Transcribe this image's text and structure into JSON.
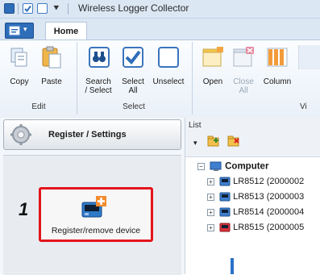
{
  "window": {
    "title": "Wireless Logger Collector"
  },
  "tabs": {
    "home": "Home"
  },
  "ribbon": {
    "edit": {
      "copy": "Copy",
      "paste": "Paste",
      "group": "Edit"
    },
    "select": {
      "search_line1": "Search",
      "search_line2": "/ Select",
      "selall_line1": "Select",
      "selall_line2": "All",
      "unselect": "Unselect",
      "group": "Select"
    },
    "view": {
      "open": "Open",
      "close_line1": "Close",
      "close_line2": "All",
      "column": "Column",
      "group_partial": "Vi"
    }
  },
  "left_panel": {
    "header": "Register / Settings",
    "step_number": "1",
    "register_button": "Register/remove device"
  },
  "list_panel": {
    "label": "List",
    "tree": {
      "root": "Computer",
      "devices": [
        "LR8512 (2000002",
        "LR8513 (2000003",
        "LR8514 (2000004",
        "LR8515 (2000005"
      ]
    }
  },
  "colors": {
    "accent": "#2e6db8",
    "highlight": "#e4141c",
    "ribbon_bg": "#dce7f4"
  }
}
